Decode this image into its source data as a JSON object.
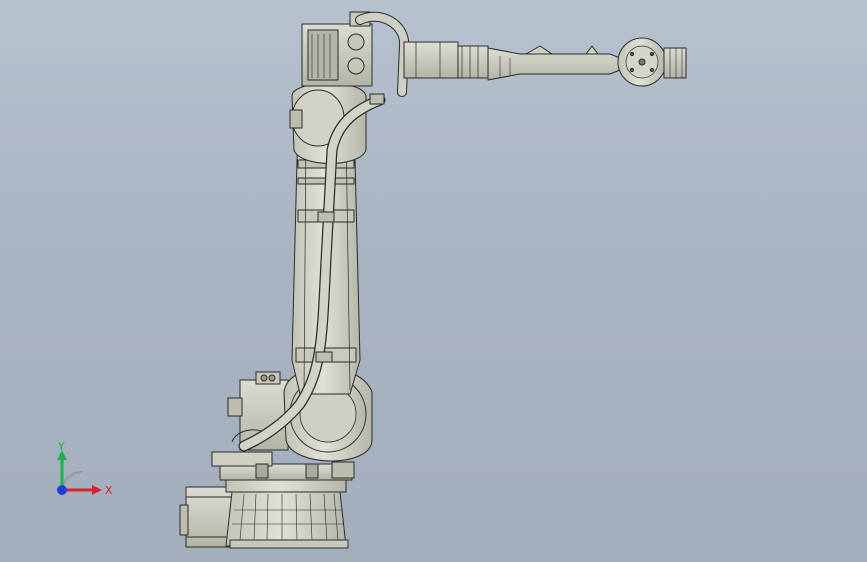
{
  "viewport": {
    "background_top": "#b7c2cf",
    "background_bottom": "#a4afbe"
  },
  "model": {
    "name_icon": "robot-arm-icon",
    "body_color": "#d4d4c8",
    "shade_color": "#b8b8aa",
    "edge_color": "#2b2b2b",
    "cable_color": "#c9c9bd"
  },
  "triad": {
    "x_label": "X",
    "y_label": "Y",
    "x_color": "#d9262b",
    "y_color": "#22b04b",
    "z_color": "#1f3fd6"
  }
}
